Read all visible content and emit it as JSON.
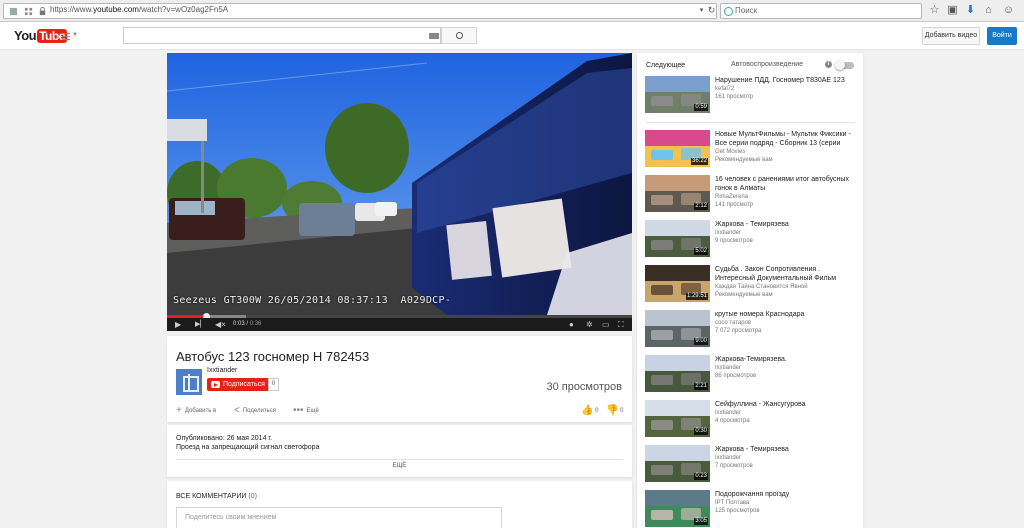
{
  "browser": {
    "url_prefix": "https://www.",
    "url_host": "youtube.com",
    "url_path": "/watch?v=wOz0ag2Fn5A",
    "search_placeholder": "Поиск"
  },
  "header": {
    "logo_you": "You",
    "logo_tube": "Tube",
    "add_video_label": "Добавить видео",
    "sign_in_label": "Войти"
  },
  "player": {
    "osd_text": "Seezeus GT300W 26/05/2014 08:37:13  A029DCP-",
    "current_time": "0:03",
    "duration": "0:36",
    "progress_fraction": 0.0833,
    "buffered_fraction": 0.17
  },
  "video": {
    "title": "Автобус 123 госномер Н 782453",
    "channel": "Ixxtiander",
    "subscribe_label": "Подписаться",
    "subscriber_count": "0",
    "views": "30 просмотров",
    "add_to_label": "Добавить в",
    "share_label": "Поделиться",
    "more_label": "Ещё",
    "likes": "0",
    "dislikes": "0"
  },
  "description": {
    "published": "Опубликовано: 26 мая 2014 г.",
    "text": "Проезд на запрещающий сигнал светофора",
    "more": "ЕЩЁ"
  },
  "comments": {
    "title": "ВСЕ КОММЕНТАРИИ",
    "count": "(0)",
    "placeholder": "Поделитесь своим мнением"
  },
  "sidebar": {
    "next_label": "Следующее",
    "autoplay_label": "Автовоспроизведение",
    "autoplay_on": false,
    "items": [
      {
        "title": "Нарушение ПДД. Госномер Т830АЕ 123",
        "channel": "kefal72",
        "views": "161 просмотр",
        "duration": "0:59",
        "palette": [
          "#7a9fcf",
          "#6f7f6a",
          "#8a8a88"
        ]
      },
      {
        "title": "Новые МультФильмы - Мультик Фиксики - Все серии подряд - Сборник 13 (серии",
        "channel": "Get Movies",
        "views": "Рекомендуемые вам",
        "duration": "36:22",
        "palette": [
          "#d94a8c",
          "#f2c14e",
          "#6fc3e8"
        ]
      },
      {
        "title": "16 человек с ранениями итог автобусных гонок в Алматы",
        "channel": "RimaZerena",
        "views": "141 просмотр",
        "duration": "2:12",
        "palette": [
          "#c79a78",
          "#5e5a4f",
          "#a58f7c"
        ]
      },
      {
        "title": "Жаркова - Темирязева",
        "channel": "Ixxtiander",
        "views": "9 просмотров",
        "duration": "5:02",
        "palette": [
          "#cfd9e6",
          "#4c5c3e",
          "#7c7c78"
        ]
      },
      {
        "title": "Судьба . Закон Сопротивления . Интересный Документальный Фильм",
        "channel": "Каждая Тайна Становится Явной",
        "views": "Рекомендуемые вам",
        "duration": "1:29:51",
        "palette": [
          "#3a2f24",
          "#c9a46b",
          "#6b5138"
        ]
      },
      {
        "title": "крутые номера Краснодара",
        "channel": "coco татаров",
        "views": "7 072 просмотра",
        "duration": "9:00",
        "palette": [
          "#b9c4cf",
          "#5d6468",
          "#9aa0a4"
        ]
      },
      {
        "title": "Жаркова-Темирязева.",
        "channel": "Ixxtiander",
        "views": "86 просмотров",
        "duration": "2:21",
        "palette": [
          "#c7d3e2",
          "#47583c",
          "#77786f"
        ]
      },
      {
        "title": "Сейфуллина - Жансугурова",
        "channel": "Ixxtiander",
        "views": "4 просмотра",
        "duration": "0:30",
        "palette": [
          "#d6dee8",
          "#53643f",
          "#8a8b84"
        ]
      },
      {
        "title": "Жаркова - Темирязева",
        "channel": "Ixxtiander",
        "views": "7 просмотров",
        "duration": "0:23",
        "palette": [
          "#cad6e4",
          "#4a5a3c",
          "#7e7f77"
        ]
      },
      {
        "title": "Подорожчання проїзду",
        "channel": "IPT Полтава",
        "views": "125 просмотров",
        "duration": "3:05",
        "palette": [
          "#5d7a8a",
          "#3e8a5a",
          "#b8b4a8"
        ]
      }
    ]
  },
  "colors": {
    "brand_red": "#e62117",
    "link_blue": "#167ac6"
  }
}
